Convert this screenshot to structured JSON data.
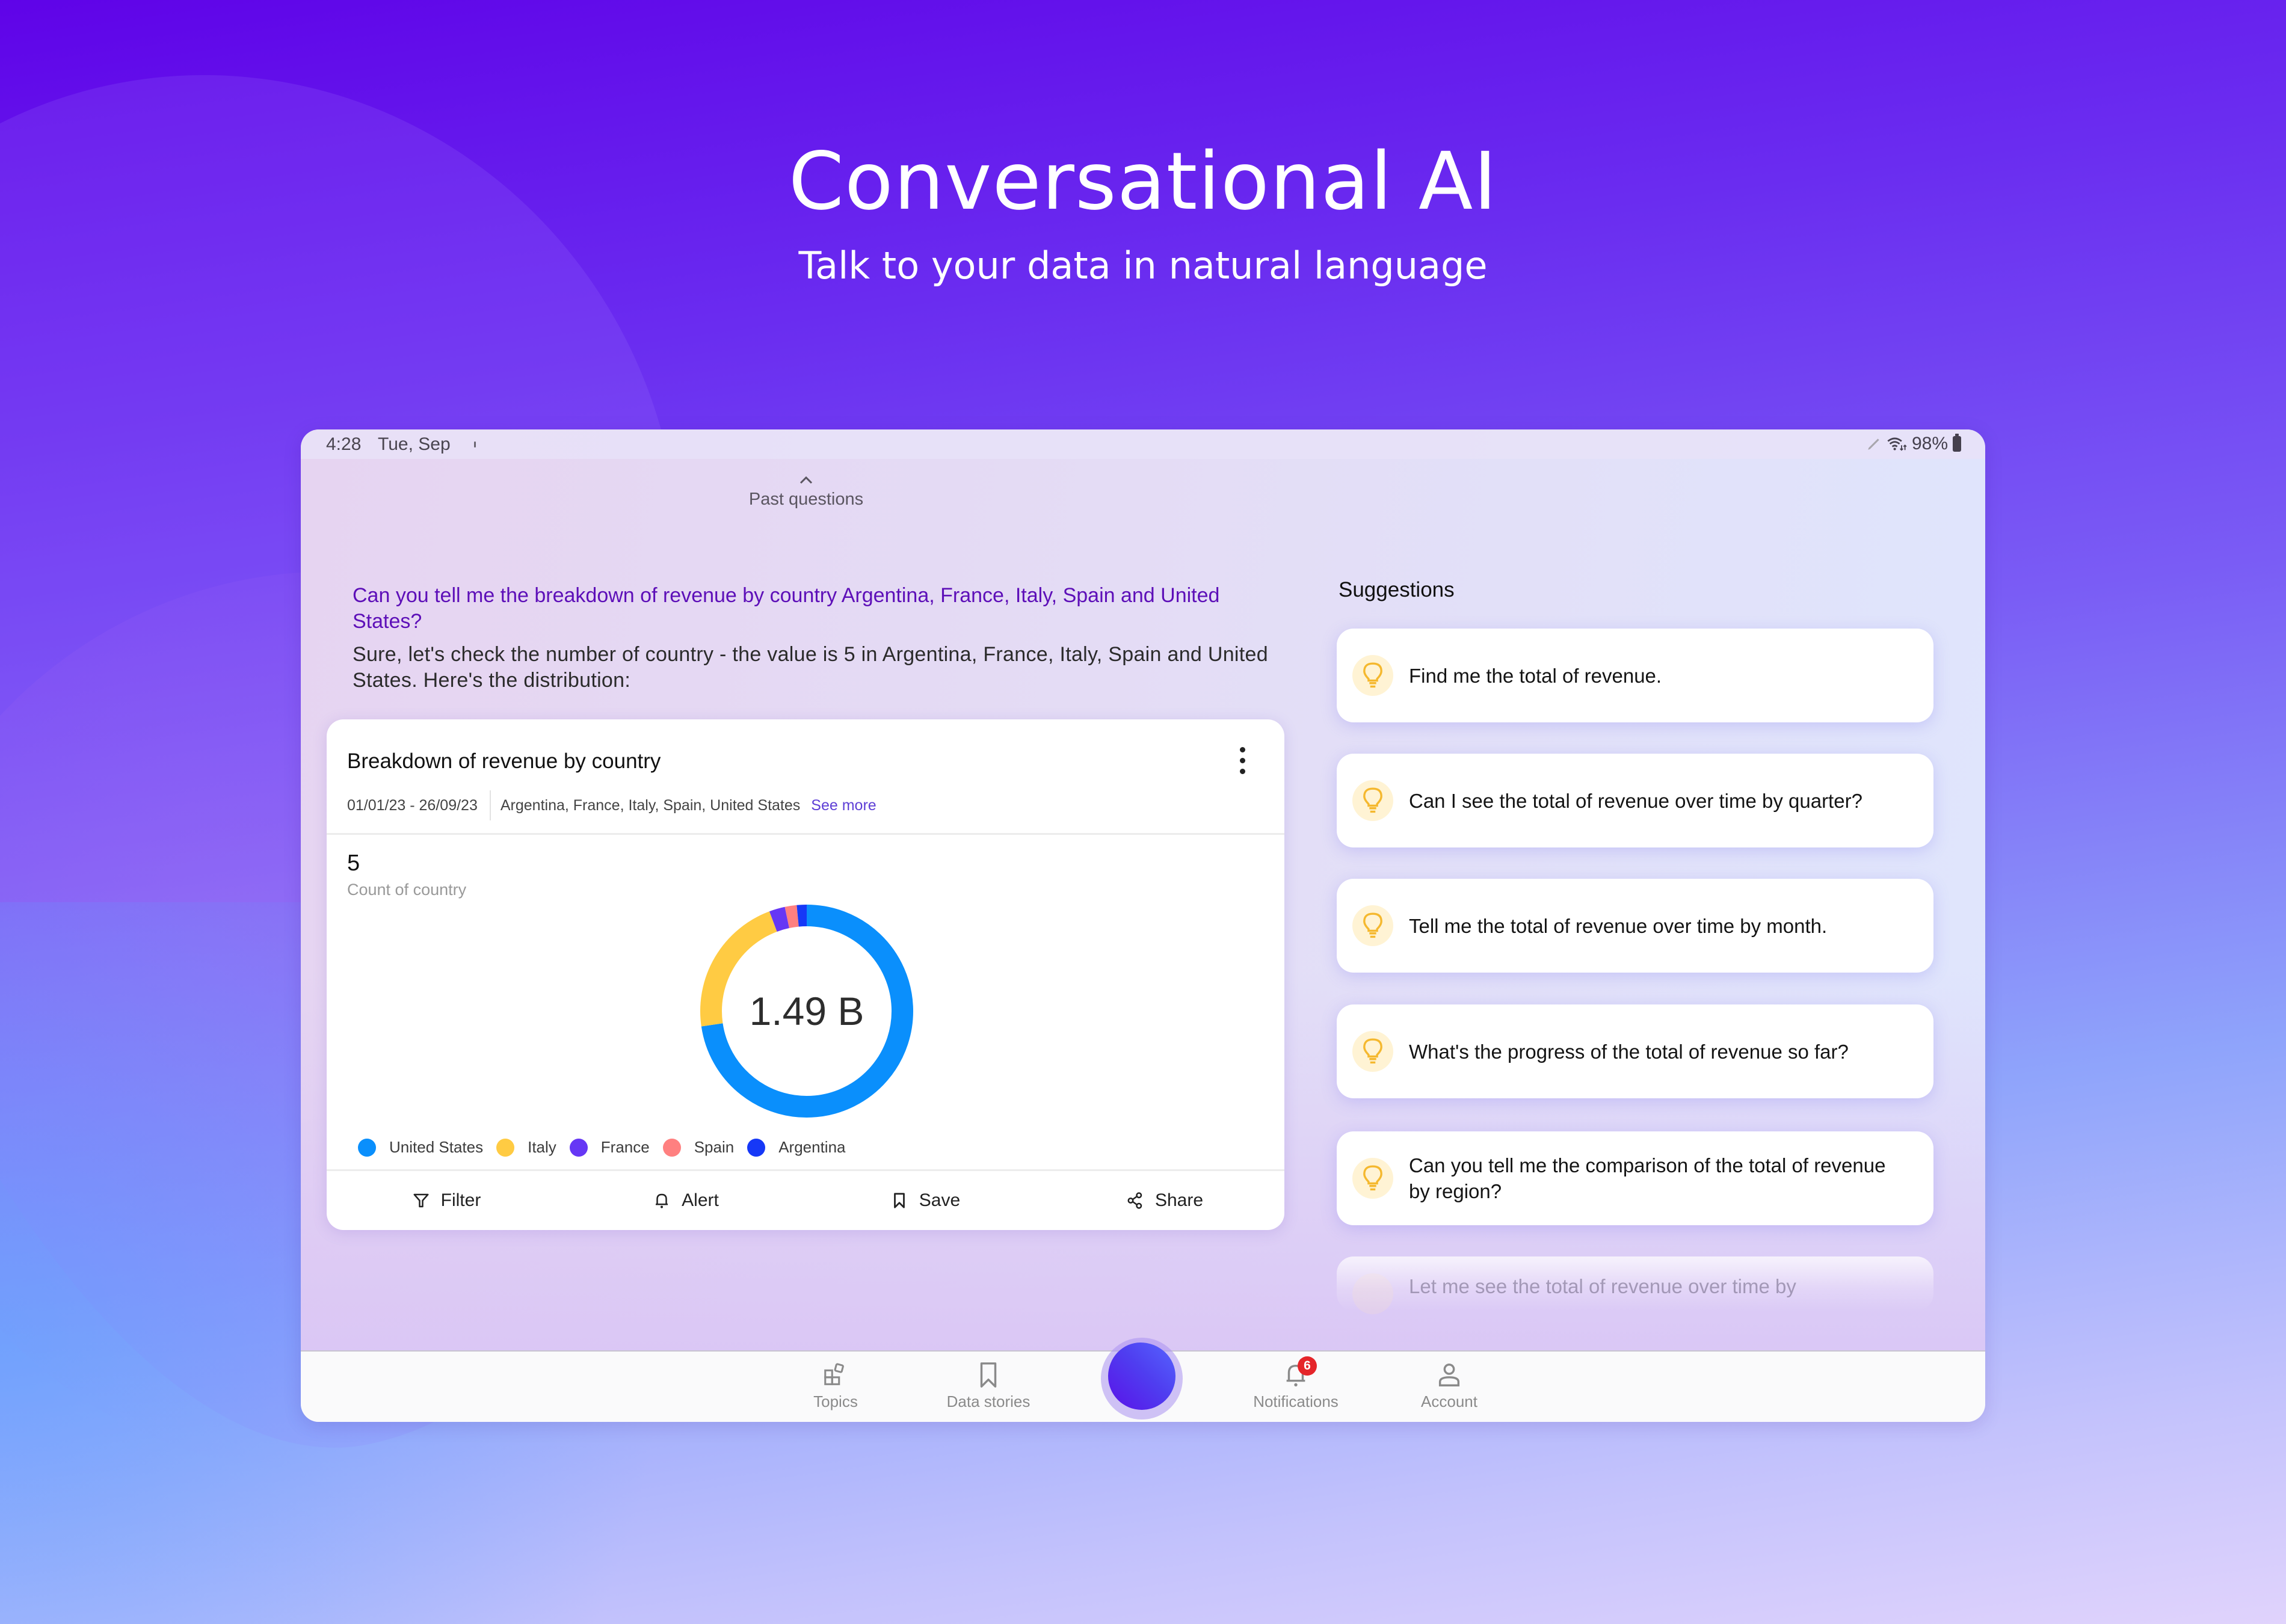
{
  "hero": {
    "title": "Conversational AI",
    "subtitle": "Talk to your data in natural language"
  },
  "status_bar": {
    "time": "4:28",
    "date": "Tue, Sep",
    "battery": "98%",
    "icons": [
      "pen-icon",
      "wifi-icon",
      "battery-icon"
    ]
  },
  "past_questions": {
    "label": "Past questions",
    "icon": "chevron-up-icon"
  },
  "conversation": {
    "question": " Can you tell me the breakdown of revenue by country Argentina, France, Italy, Spain and United States?",
    "answer": "Sure, let's check the number of country - the value is 5 in Argentina, France, Italy, Spain and United States. Here's the distribution:"
  },
  "chart_card": {
    "title": "Breakdown of revenue by country",
    "date_range": "01/01/23 - 26/09/23",
    "countries": "Argentina, France, Italy, Spain, United States",
    "see_more": "See more",
    "kpi_value": "5",
    "kpi_label": "Count of country",
    "center_label": "1.49 B",
    "actions": [
      {
        "label": "Filter",
        "icon": "filter-icon"
      },
      {
        "label": "Alert",
        "icon": "bell-icon"
      },
      {
        "label": "Save",
        "icon": "bookmark-icon"
      },
      {
        "label": "Share",
        "icon": "share-icon"
      }
    ]
  },
  "chart_data": {
    "type": "pie",
    "variant": "donut",
    "title": "Breakdown of revenue by country",
    "center_text": "1.49 B",
    "total": 1.49,
    "unit": "B",
    "categories": [
      "United States",
      "Italy",
      "France",
      "Spain",
      "Argentina"
    ],
    "values_percent": [
      72.7,
      21.6,
      2.4,
      1.8,
      1.5
    ],
    "colors": [
      "#0a8ffc",
      "#ffcb43",
      "#6637f5",
      "#ff8080",
      "#1638f7"
    ],
    "start_angle": "top, clockwise (Argentina segment ends at 12 o'clock)",
    "legend_position": "bottom-left"
  },
  "suggestions": {
    "title": "Suggestions",
    "items": [
      {
        "text": "Find me the total of revenue."
      },
      {
        "text": "Can I see the total of revenue over time by quarter?"
      },
      {
        "text": "Tell me the total of revenue over time by month."
      },
      {
        "text": "What's the progress of the total of revenue so far?"
      },
      {
        "text": "Can you tell me the comparison of the total of revenue by region?"
      },
      {
        "text": "Let me see the total of revenue over time by"
      }
    ]
  },
  "bottom_nav": {
    "items": [
      {
        "label": "Topics",
        "icon": "topics-icon"
      },
      {
        "label": "Data stories",
        "icon": "bookmark-icon"
      },
      {
        "label": "Notifications",
        "icon": "bell-icon",
        "badge": "6"
      },
      {
        "label": "Account",
        "icon": "account-icon"
      }
    ],
    "fab": "ai-assistant-orb"
  }
}
